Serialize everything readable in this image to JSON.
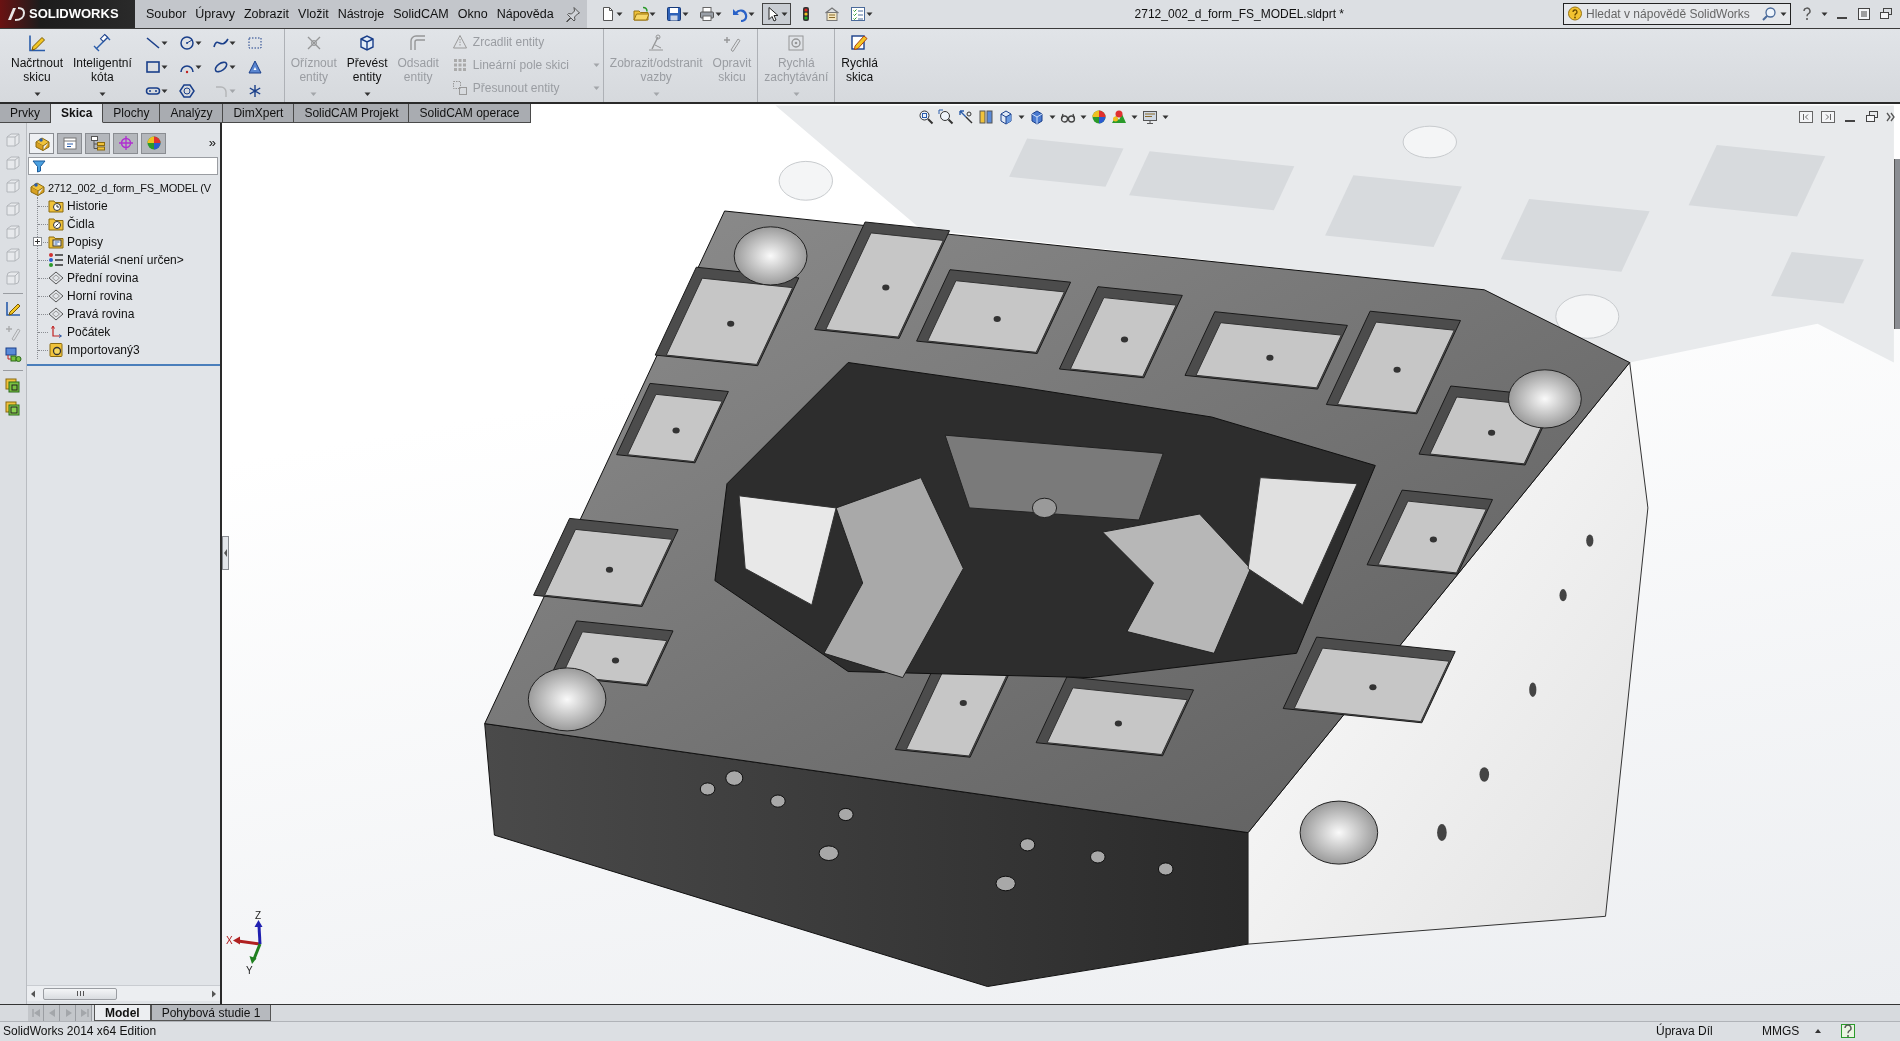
{
  "app": {
    "logo": "SOLIDWORKS"
  },
  "menu": [
    "Soubor",
    "Úpravy",
    "Zobrazit",
    "Vložit",
    "Nástroje",
    "SolidCAM",
    "Okno",
    "Nápověda"
  ],
  "quick_access": [
    {
      "dropdown": true,
      "selected": false
    },
    {
      "dropdown": true,
      "selected": false
    },
    {
      "dropdown": true,
      "selected": false
    },
    {
      "dropdown": true,
      "selected": false
    },
    {
      "dropdown": true,
      "selected": false
    },
    {
      "dropdown": true,
      "selected": true
    },
    {
      "dropdown": false,
      "selected": false
    },
    {
      "dropdown": false,
      "selected": false
    },
    {
      "dropdown": true,
      "selected": false
    }
  ],
  "window": {
    "title": "2712_002_d_form_FS_MODEL.sldprt *"
  },
  "help_search": {
    "placeholder": "Hledat v nápovědě SolidWorks"
  },
  "ribbon": [
    {
      "items": [
        {
          "kind": "large",
          "label": "Načrtnout skicu",
          "disabled": false,
          "dropdown": true
        },
        {
          "kind": "large",
          "label": "Inteligentní kóta",
          "disabled": false,
          "dropdown": true
        },
        {
          "kind": "tools",
          "tools": [
            {
              "dropdown": true,
              "disabled": false
            },
            {
              "dropdown": true,
              "disabled": false
            },
            {
              "dropdown": true,
              "disabled": false
            },
            {
              "dropdown": false,
              "disabled": false
            },
            {
              "dropdown": true,
              "disabled": false
            },
            {
              "dropdown": true,
              "disabled": false
            },
            {
              "dropdown": true,
              "disabled": false
            },
            {
              "dropdown": false,
              "disabled": false
            },
            {
              "dropdown": true,
              "disabled": false
            },
            {
              "dropdown": false,
              "disabled": false
            },
            {
              "dropdown": true,
              "disabled": true
            },
            {
              "dropdown": false,
              "disabled": false
            }
          ]
        }
      ]
    },
    {
      "items": [
        {
          "kind": "large",
          "label": "Oříznout entity",
          "disabled": true,
          "dropdown": true
        },
        {
          "kind": "large",
          "label": "Převést entity",
          "disabled": false,
          "dropdown": true
        },
        {
          "kind": "large",
          "label": "Odsadit entity",
          "disabled": true,
          "dropdown": false
        },
        {
          "kind": "list",
          "rows": [
            {
              "label": "Zrcadlit entity",
              "disabled": true,
              "dropdown": false
            },
            {
              "label": "Lineární pole skici",
              "disabled": true,
              "dropdown": true
            },
            {
              "label": "Přesunout entity",
              "disabled": true,
              "dropdown": true
            }
          ]
        }
      ]
    },
    {
      "items": [
        {
          "kind": "large",
          "label": "Zobrazit/odstranit vazby",
          "disabled": true,
          "dropdown": true
        },
        {
          "kind": "large",
          "label": "Opravit skicu",
          "disabled": true,
          "dropdown": false
        }
      ]
    },
    {
      "items": [
        {
          "kind": "large",
          "label": "Rychlá zachytávání",
          "disabled": true,
          "dropdown": true
        }
      ]
    },
    {
      "items": [
        {
          "kind": "large",
          "label": "Rychlá skica",
          "disabled": false,
          "dropdown": false
        }
      ]
    }
  ],
  "command_tabs": [
    {
      "label": "Prvky",
      "selected": false
    },
    {
      "label": "Skica",
      "selected": true
    },
    {
      "label": "Plochy",
      "selected": false
    },
    {
      "label": "Analýzy",
      "selected": false
    },
    {
      "label": "DimXpert",
      "selected": false
    },
    {
      "label": "SolidCAM Projekt",
      "selected": false
    },
    {
      "label": "SolidCAM operace",
      "selected": false
    }
  ],
  "view_toolbar": [
    {
      "dropdown": false
    },
    {
      "dropdown": false
    },
    {
      "dropdown": false
    },
    {
      "dropdown": false
    },
    {
      "dropdown": true
    },
    {
      "dropdown": true
    },
    {
      "dropdown": true
    },
    {
      "dropdown": false
    },
    {
      "dropdown": true
    },
    {
      "dropdown": true
    }
  ],
  "side_toolbar": [
    {
      "disabled": true
    },
    {
      "disabled": true
    },
    {
      "disabled": true
    },
    {
      "disabled": true
    },
    {
      "disabled": true
    },
    {
      "disabled": true
    },
    {
      "disabled": true
    },
    {
      "disabled": false
    },
    {
      "disabled": true
    },
    {
      "disabled": false
    },
    {
      "disabled": false
    },
    {
      "disabled": false
    }
  ],
  "feature_manager": {
    "tabs": [
      {
        "selected": true
      },
      {
        "selected": false
      },
      {
        "selected": false
      },
      {
        "selected": false
      },
      {
        "selected": false
      }
    ],
    "more": "»",
    "tree": {
      "label": "2712_002_d_form_FS_MODEL (V",
      "children": [
        {
          "label": "Historie",
          "expandable": false
        },
        {
          "label": "Čidla",
          "expandable": false
        },
        {
          "label": "Popisy",
          "expandable": true
        },
        {
          "label": "Materiál <není určen>",
          "expandable": false
        },
        {
          "label": "Přední rovina",
          "expandable": false
        },
        {
          "label": "Horní rovina",
          "expandable": false
        },
        {
          "label": "Pravá rovina",
          "expandable": false
        },
        {
          "label": "Počátek",
          "expandable": false
        },
        {
          "label": "Importovaný3",
          "expandable": false
        }
      ]
    }
  },
  "triad": {
    "x": "X",
    "y": "Y",
    "z": "Z"
  },
  "bottom_nav": [
    {
      "disabled": true
    },
    {
      "disabled": true
    },
    {
      "disabled": true
    },
    {
      "disabled": true
    }
  ],
  "bottom_tabs": [
    {
      "label": "Model",
      "selected": true
    },
    {
      "label": "Pohybová studie 1",
      "selected": false
    }
  ],
  "status_bar": {
    "edition": "SolidWorks 2014 x64 Edition",
    "mode": "Úprava Díl",
    "units": "MMGS"
  }
}
